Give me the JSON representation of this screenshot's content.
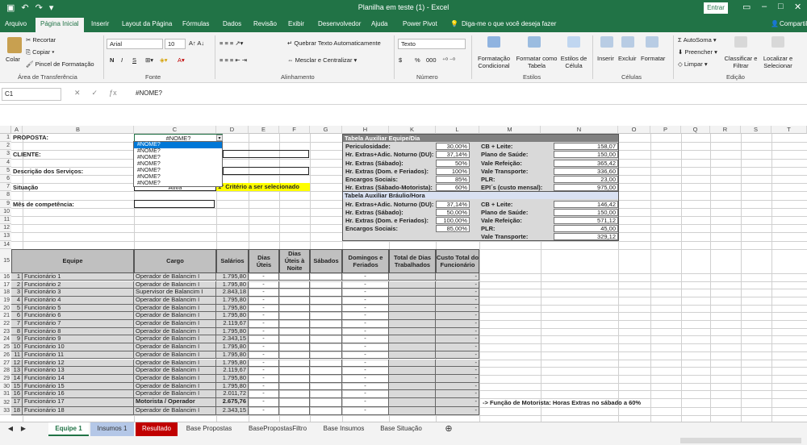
{
  "window": {
    "title": "Planilha em teste (1)  -  Excel",
    "signin": "Entrar"
  },
  "menu": {
    "tabs": [
      "Arquivo",
      "Página Inicial",
      "Inserir",
      "Layout da Página",
      "Fórmulas",
      "Dados",
      "Revisão",
      "Exibir",
      "Desenvolvedor",
      "Ajuda",
      "Power Pivot"
    ],
    "tell_me": "Diga-me o que você deseja fazer",
    "share": "Compartilhar"
  },
  "ribbon": {
    "clipboard": {
      "paste": "Colar",
      "cut": "Recortar",
      "copy": "Copiar",
      "painter": "Pincel de Formatação",
      "label": "Área de Transferência"
    },
    "font": {
      "name": "Arial",
      "size": "10",
      "bold": "N",
      "italic": "I",
      "underline": "S",
      "label": "Fonte"
    },
    "alignment": {
      "wrap": "Quebrar Texto Automaticamente",
      "merge": "Mesclar e Centralizar",
      "label": "Alinhamento"
    },
    "number": {
      "format": "Texto",
      "currency": "$",
      "percent": "%",
      "thousands": "000",
      "label": "Número"
    },
    "styles": {
      "conditional": "Formatação Condicional",
      "as_table": "Formatar como Tabela",
      "cell_styles": "Estilos de Célula",
      "label": "Estilos"
    },
    "cells": {
      "insert": "Inserir",
      "delete": "Excluir",
      "format": "Formatar",
      "label": "Células"
    },
    "editing": {
      "autosum": "AutoSoma",
      "fill": "Preencher",
      "clear": "Limpar",
      "sort": "Classificar e Filtrar",
      "find": "Localizar e Selecionar",
      "label": "Edição"
    }
  },
  "formula_bar": {
    "name_box": "C1",
    "formula": "#NOME?"
  },
  "columns": [
    "A",
    "B",
    "C",
    "D",
    "E",
    "F",
    "G",
    "H",
    "K",
    "L",
    "M",
    "N",
    "O",
    "P",
    "Q",
    "R",
    "S",
    "T"
  ],
  "rows": [
    "1",
    "2",
    "3",
    "4",
    "5",
    "6",
    "7",
    "8",
    "9",
    "10",
    "11",
    "12",
    "13",
    "14",
    "15",
    "16",
    "17",
    "18",
    "19",
    "20",
    "21",
    "22",
    "23",
    "24",
    "25",
    "26",
    "27",
    "28",
    "29",
    "30",
    "31",
    "32",
    "33"
  ],
  "form": {
    "proposta": "PROPOSTA:",
    "cliente": "CLIENTE:",
    "descricao": "Descrição dos Serviços:",
    "situacao": "Situação",
    "situacao_value": "Ativa",
    "criterio": "1° Critério a ser selecionado",
    "mes": "Mês de competência:",
    "c1_value": "#NOME?"
  },
  "dropdown": [
    "#NOME?",
    "#NOME?",
    "#NOME?",
    "#NOME?",
    "#NOME?",
    "#NOME?",
    "#NOME?"
  ],
  "aux1": {
    "title": "Tabela Auxiliar Equipe/Dia",
    "left": [
      {
        "label": "Periculosidade:",
        "value": "30,00%"
      },
      {
        "label": "Hr. Extras+Adic. Noturno (DU):",
        "value": "37,14%"
      },
      {
        "label": "Hr. Extras (Sábado):",
        "value": "50%"
      },
      {
        "label": "Hr. Extras (Dom. e Feriados):",
        "value": "100%"
      },
      {
        "label": "Encargos Sociais:",
        "value": "85%"
      },
      {
        "label": "Hr. Extras (Sábado-Motorista):",
        "value": "60%"
      }
    ],
    "right": [
      {
        "label": "CB + Leite:",
        "value": "158,07"
      },
      {
        "label": "Plano de Saúde:",
        "value": "150,00"
      },
      {
        "label": "Vale Refeição:",
        "value": "365,42"
      },
      {
        "label": "Vale Transporte:",
        "value": "336,60"
      },
      {
        "label": "PLR:",
        "value": "23,00"
      },
      {
        "label": "EPI´s (custo mensal):",
        "value": "975,00"
      }
    ]
  },
  "aux2": {
    "title": "Tabela Auxiliar Bráulio/Hora",
    "left": [
      {
        "label": "Hr. Extras+Adic. Noturno (DU):",
        "value": "37,14%"
      },
      {
        "label": "Hr. Extras (Sábado):",
        "value": "50,00%"
      },
      {
        "label": "Hr. Extras (Dom. e Feriados):",
        "value": "100,00%"
      },
      {
        "label": "Encargos Sociais:",
        "value": "85,00%"
      }
    ],
    "right": [
      {
        "label": "CB + Leite:",
        "value": "146,42"
      },
      {
        "label": "Plano de Saúde:",
        "value": "150,00"
      },
      {
        "label": "Vale Refeição:",
        "value": "571,12"
      },
      {
        "label": "PLR:",
        "value": "45,00"
      },
      {
        "label": "Vale Transporte:",
        "value": "329,12"
      }
    ]
  },
  "table": {
    "headers": [
      "Equipe",
      "Cargo",
      "Salários",
      "Dias Úteis",
      "Dias Úteis à Noite",
      "Sábados",
      "Domingos e Feriados",
      "Total de Dias Trabalhados",
      "Custo Total do Funcionário"
    ],
    "rows": [
      {
        "n": "1",
        "name": "Funcionário 1",
        "cargo": "Operador de Balancim I",
        "sal": "1.795,80"
      },
      {
        "n": "2",
        "name": "Funcionário 2",
        "cargo": "Operador de Balancim I",
        "sal": "1.795,80"
      },
      {
        "n": "3",
        "name": "Funcionário 3",
        "cargo": "Supervisor de Balancim I",
        "sal": "2.843,18"
      },
      {
        "n": "4",
        "name": "Funcionário 4",
        "cargo": "Operador de Balancim I",
        "sal": "1.795,80"
      },
      {
        "n": "5",
        "name": "Funcionário 5",
        "cargo": "Operador de Balancim I",
        "sal": "1.795,80"
      },
      {
        "n": "6",
        "name": "Funcionário 6",
        "cargo": "Operador de Balancim I",
        "sal": "1.795,80"
      },
      {
        "n": "7",
        "name": "Funcionário 7",
        "cargo": "Operador de Balancim I",
        "sal": "2.119,67"
      },
      {
        "n": "8",
        "name": "Funcionário 8",
        "cargo": "Operador de Balancim I",
        "sal": "1.795,80"
      },
      {
        "n": "9",
        "name": "Funcionário 9",
        "cargo": "Operador de Balancim I",
        "sal": "2.343,15"
      },
      {
        "n": "10",
        "name": "Funcionário 10",
        "cargo": "Operador de Balancim I",
        "sal": "1.795,80"
      },
      {
        "n": "11",
        "name": "Funcionário 11",
        "cargo": "Operador de Balancim I",
        "sal": "1.795,80"
      },
      {
        "n": "12",
        "name": "Funcionário 12",
        "cargo": "Operador de Balancim I",
        "sal": "1.795,80"
      },
      {
        "n": "13",
        "name": "Funcionário 13",
        "cargo": "Operador de Balancim I",
        "sal": "2.119,67"
      },
      {
        "n": "14",
        "name": "Funcionário 14",
        "cargo": "Operador de Balancim I",
        "sal": "1.795,80"
      },
      {
        "n": "15",
        "name": "Funcionário 15",
        "cargo": "Operador de Balancim I",
        "sal": "1.795,80"
      },
      {
        "n": "16",
        "name": "Funcionário 16",
        "cargo": "Operador de Balancim I",
        "sal": "2.011,72"
      },
      {
        "n": "17",
        "name": "Funcionário 17",
        "cargo": "Motorista / Operador",
        "sal": "2.675,76"
      },
      {
        "n": "18",
        "name": "Funcionário 18",
        "cargo": "Operador de Balancim I",
        "sal": "2.343,15"
      }
    ],
    "dash": "-"
  },
  "note": "-> Função de Motorista: Horas Extras no sábado a 60%",
  "sheets": [
    "Equipe 1",
    "Insumos 1",
    "Resultado",
    "Base Propostas",
    "BasePropostasFiltro",
    "Base Insumos",
    "Base Situação"
  ],
  "colors": {
    "excel_green": "#217346",
    "tab_blue": "#b4c7e7",
    "tab_red": "#c00000",
    "yellow": "#ffff00"
  }
}
